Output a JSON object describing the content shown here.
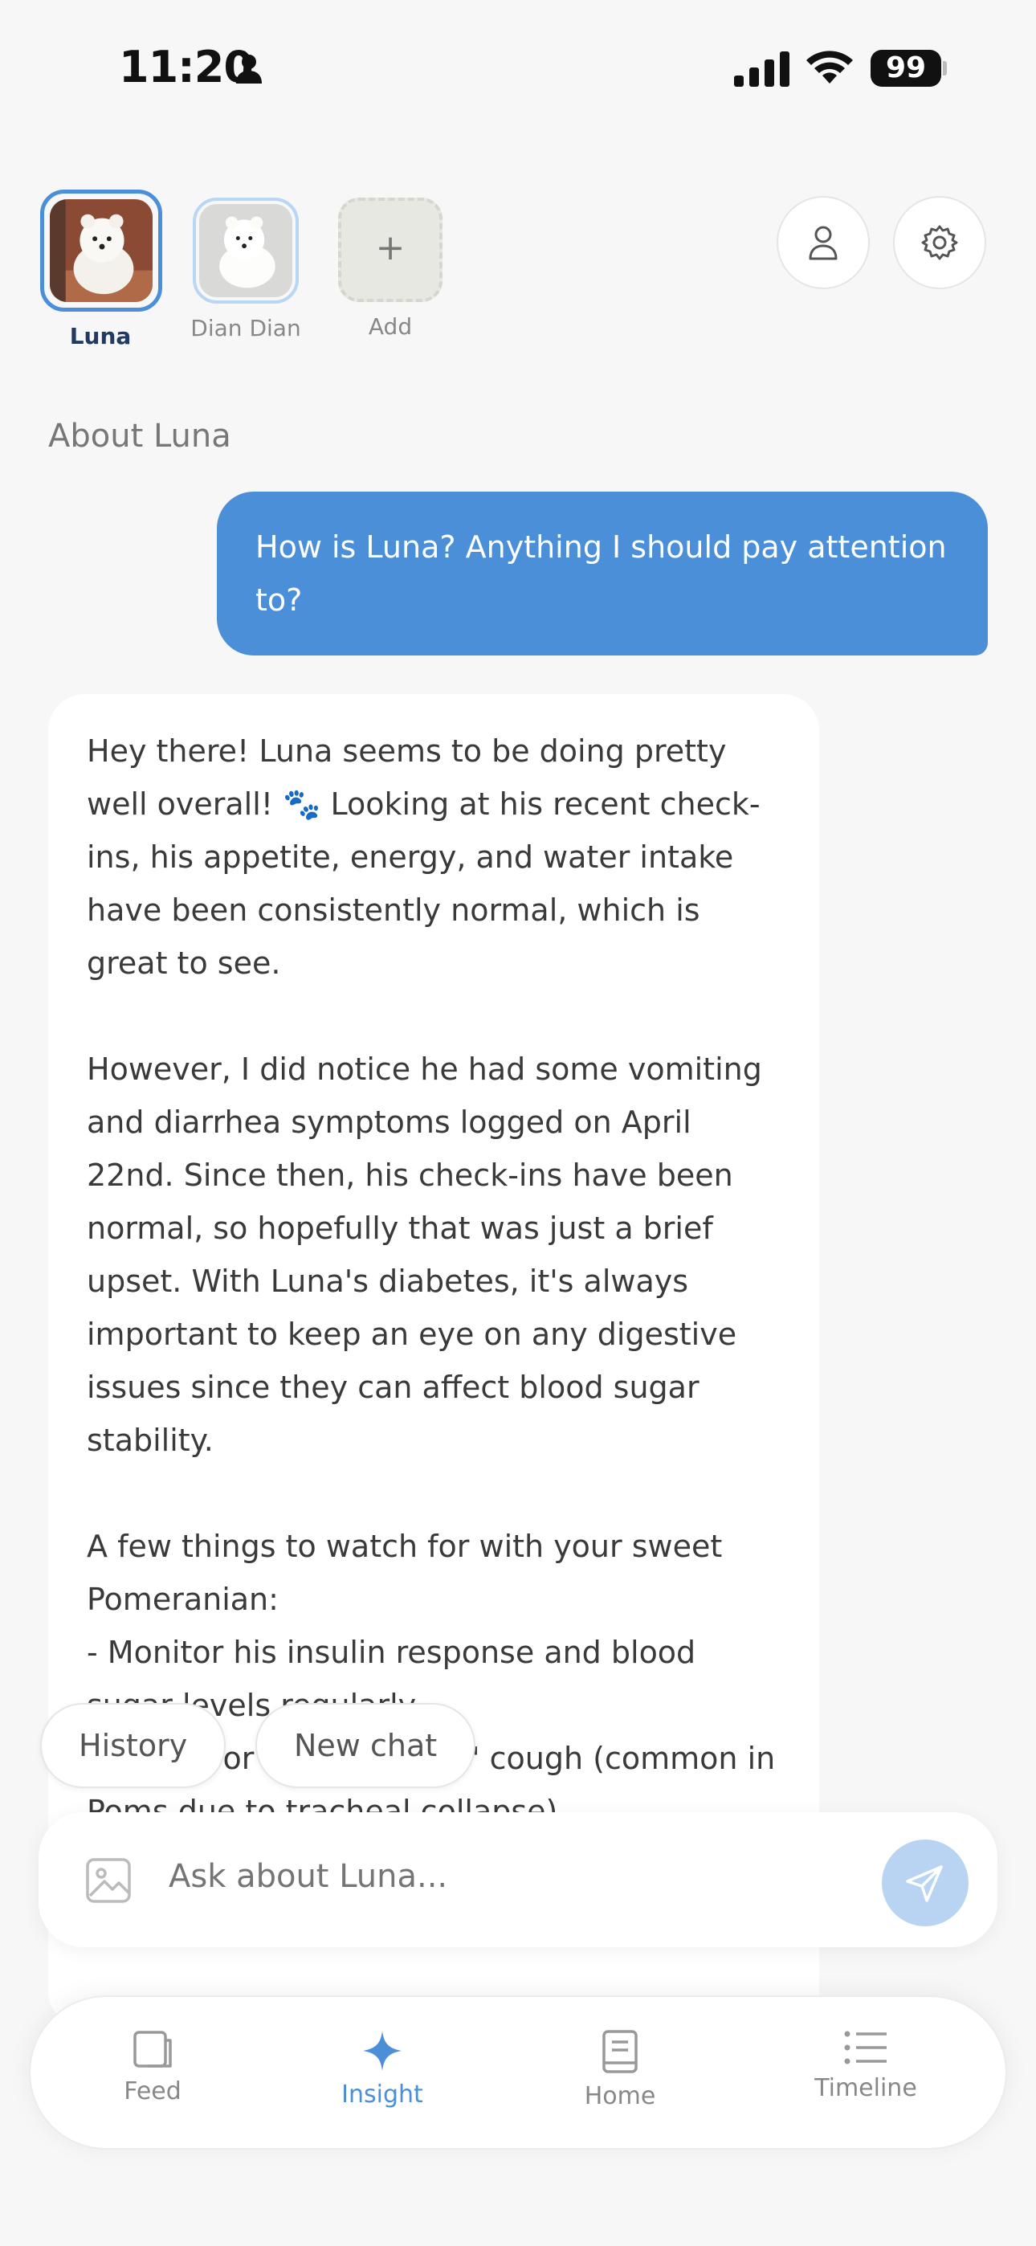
{
  "status": {
    "time": "11:20",
    "battery": "99"
  },
  "pets": [
    {
      "name": "Luna"
    },
    {
      "name": "Dian Dian"
    },
    {
      "name": "Add"
    }
  ],
  "section_title": "About Luna",
  "user_message": "How is Luna? Anything I should pay attention to?",
  "ai_message": {
    "p1": "Hey there! Luna seems to be doing pretty well overall! 🐾 Looking at his recent check-ins, his appetite, energy, and water intake have been consistently normal, which is great to see.",
    "p2": "However, I did notice he had some vomiting and diarrhea symptoms logged on April 22nd. Since then, his check-ins have been normal, so hopefully that was just a brief upset. With Luna's diabetes, it's always important to keep an eye on any digestive issues since they can affect blood sugar stability.",
    "p3": "A few things to watch for with your sweet Pomeranian:\n- Monitor his insulin response and blood sugar levels regularly\n- Watch for any \"honking\" cough (common in Poms due to tracheal collapse)"
  },
  "pills": {
    "history": "History",
    "new_chat": "New chat"
  },
  "input": {
    "placeholder": "Ask about Luna..."
  },
  "nav": [
    {
      "label": "Feed",
      "icon": "feed-icon"
    },
    {
      "label": "Insight",
      "icon": "sparkle-icon"
    },
    {
      "label": "Home",
      "icon": "book-icon"
    },
    {
      "label": "Timeline",
      "icon": "list-icon"
    }
  ],
  "colors": {
    "accent": "#4a8fd8",
    "send_disabled": "#b8d4f2"
  }
}
